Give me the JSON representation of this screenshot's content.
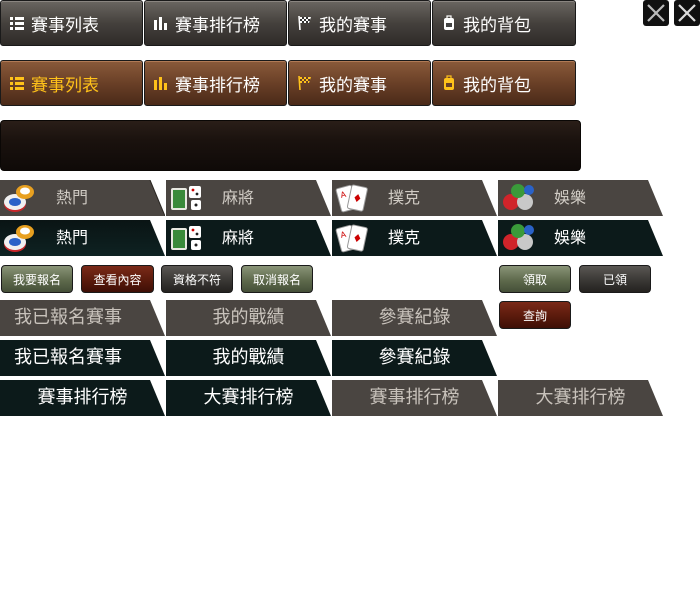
{
  "top_tabs_row1": [
    {
      "label": "賽事列表",
      "icon": "list-icon"
    },
    {
      "label": "賽事排行榜",
      "icon": "bar-chart-icon"
    },
    {
      "label": "我的賽事",
      "icon": "checkered-flag-icon"
    },
    {
      "label": "我的背包",
      "icon": "backpack-icon"
    }
  ],
  "top_tabs_row2": [
    {
      "label": "賽事列表",
      "icon": "list-icon"
    },
    {
      "label": "賽事排行榜",
      "icon": "bar-chart-icon"
    },
    {
      "label": "我的賽事",
      "icon": "checkered-flag-icon"
    },
    {
      "label": "我的背包",
      "icon": "backpack-icon"
    }
  ],
  "category_tabs_light": [
    {
      "label": "熱門",
      "icon": "poker-chips-icon"
    },
    {
      "label": "麻將",
      "icon": "mahjong-dice-icon"
    },
    {
      "label": "撲克",
      "icon": "playing-cards-icon"
    },
    {
      "label": "娛樂",
      "icon": "colored-balls-icon"
    }
  ],
  "category_tabs_dark": [
    {
      "label": "熱門",
      "icon": "poker-chips-icon"
    },
    {
      "label": "麻將",
      "icon": "mahjong-dice-icon"
    },
    {
      "label": "撲克",
      "icon": "playing-cards-icon"
    },
    {
      "label": "娛樂",
      "icon": "colored-balls-icon"
    }
  ],
  "actions": {
    "signup": "我要報名",
    "view_content": "查看內容",
    "not_qualified": "資格不符",
    "cancel_signup": "取消報名",
    "claim": "領取",
    "claimed": "已領",
    "query": "查詢"
  },
  "my_tabs_light": [
    "我已報名賽事",
    "我的戰績",
    "參賽紀錄"
  ],
  "my_tabs_dark": [
    "我已報名賽事",
    "我的戰績",
    "參賽紀錄"
  ],
  "ranking_tabs": [
    "賽事排行榜",
    "大賽排行榜",
    "賽事排行榜",
    "大賽排行榜"
  ]
}
